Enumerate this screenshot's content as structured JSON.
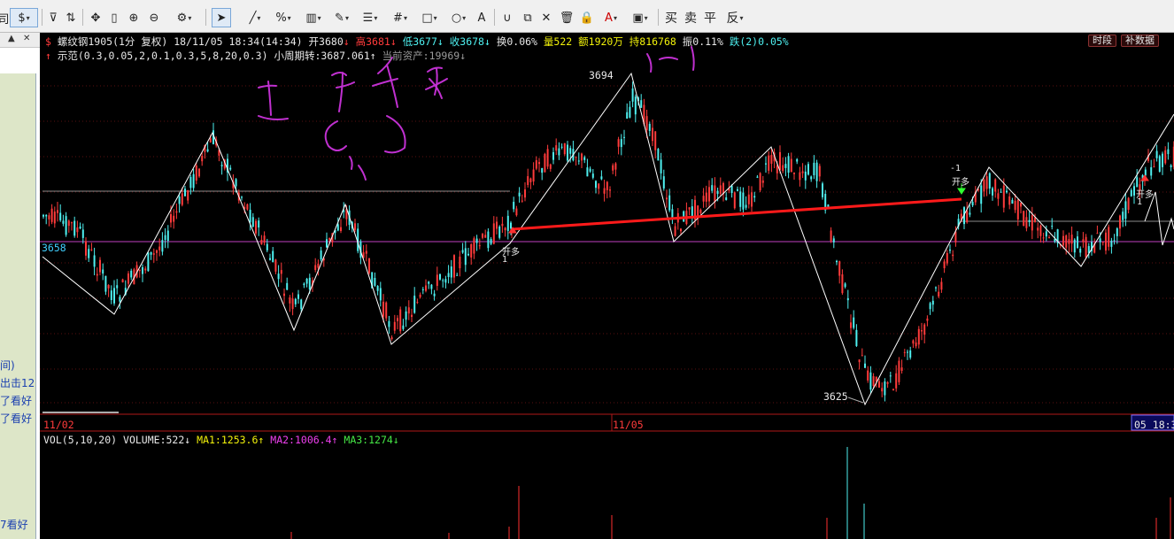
{
  "toolbar": {
    "currency_label": "$",
    "text_tools": [
      "买",
      "卖",
      "平",
      "反"
    ]
  },
  "left_panel": {
    "header_text": "▲ ✕",
    "items": [
      "间)",
      "出击12",
      "了看好",
      "了看好",
      "7看好"
    ]
  },
  "chart": {
    "info_row1": {
      "symbol_icon": "$",
      "name": "螺纹钢1905(1分 复权)",
      "datetime": "18/11/05 18:34(14:34)",
      "open": "开3680",
      "high": "高3681",
      "low": "低3677",
      "close": "收3678",
      "turnover": "换0.06%",
      "volume": "量522",
      "amount": "额1920万",
      "position": "持816768",
      "amplitude": "振0.11%",
      "change": "跌(2)0.05%"
    },
    "info_row2": {
      "indicator": "示范(0.3,0.05,2,0.1,0.3,5,8,20,0.3)",
      "cycle": "小周期转:3687.061",
      "asset": "当前资产:19969"
    },
    "btn_time": "时段",
    "btn_fill": "补数据",
    "labels": {
      "price_high": "3694",
      "price_low": "3625",
      "price_level": "3658",
      "open_long_1": "开多",
      "open_long_1_n": "1",
      "open_long_2": "开多",
      "open_long_2_n": "-1",
      "open_long_3": "开多",
      "open_long_3_n": "1"
    },
    "date_axis": {
      "d1": "11/02",
      "d2": "11/05",
      "d3": "05 18:3"
    },
    "volume_row": {
      "label": "VOL(5,10,20)",
      "volume": "VOLUME:522",
      "ma1": "MA1:1253.6",
      "ma2": "MA2:1006.4",
      "ma3": "MA3:1274"
    },
    "colors": {
      "up": "#ff3b3b",
      "down": "#4ef0f0",
      "zigzag": "#ffffff",
      "trendline": "#ff1a1a",
      "level_line": "#c040c0",
      "annotation": "#c030d0"
    }
  }
}
